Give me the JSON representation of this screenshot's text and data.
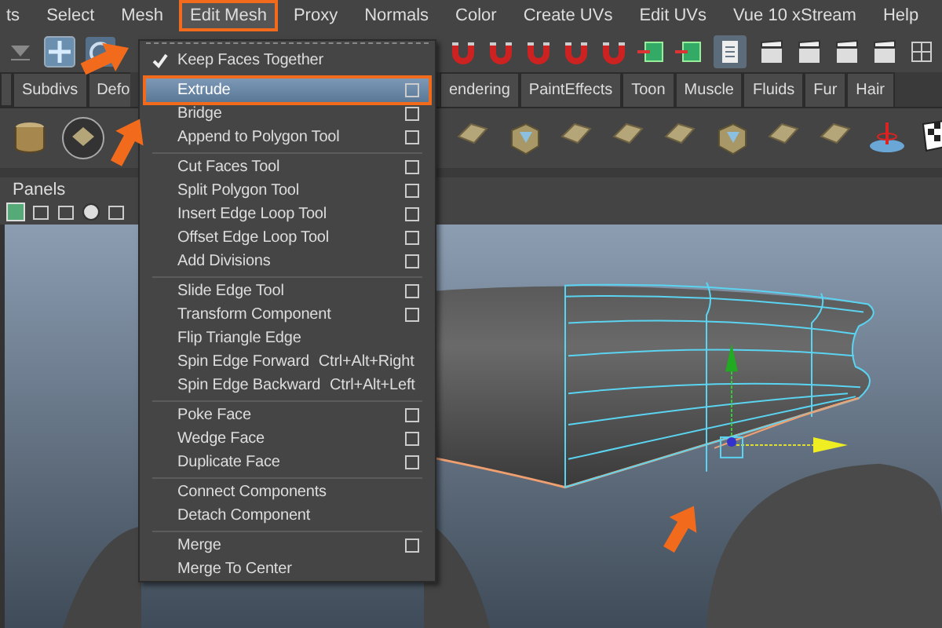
{
  "menu_bar": {
    "items": [
      {
        "label": "ts",
        "selected": false
      },
      {
        "label": "Select",
        "selected": false
      },
      {
        "label": "Mesh",
        "selected": false
      },
      {
        "label": "Edit Mesh",
        "selected": true
      },
      {
        "label": "Proxy",
        "selected": false
      },
      {
        "label": "Normals",
        "selected": false
      },
      {
        "label": "Color",
        "selected": false
      },
      {
        "label": "Create UVs",
        "selected": false
      },
      {
        "label": "Edit UVs",
        "selected": false
      },
      {
        "label": "Vue 10 xStream",
        "selected": false
      },
      {
        "label": "Help",
        "selected": false
      }
    ]
  },
  "shelf_tabs": [
    {
      "label": "Subdivs"
    },
    {
      "label": "Defo"
    },
    {
      "label": "endering"
    },
    {
      "label": "PaintEffects"
    },
    {
      "label": "Toon"
    },
    {
      "label": "Muscle"
    },
    {
      "label": "Fluids"
    },
    {
      "label": "Fur"
    },
    {
      "label": "Hair"
    }
  ],
  "panels_menu": {
    "label": "Panels"
  },
  "edit_mesh_menu": {
    "toggle": {
      "label": "Keep Faces Together",
      "checked": true
    },
    "groups": [
      [
        {
          "label": "Extrude",
          "selected": true,
          "option_box": true
        },
        {
          "label": "Bridge",
          "selected": false,
          "option_box": true
        },
        {
          "label": "Append to Polygon Tool",
          "selected": false,
          "option_box": true
        }
      ],
      [
        {
          "label": "Cut Faces Tool",
          "selected": false,
          "option_box": true
        },
        {
          "label": "Split Polygon Tool",
          "selected": false,
          "option_box": true
        },
        {
          "label": "Insert Edge Loop Tool",
          "selected": false,
          "option_box": true
        },
        {
          "label": "Offset Edge Loop Tool",
          "selected": false,
          "option_box": true
        },
        {
          "label": "Add Divisions",
          "selected": false,
          "option_box": true
        }
      ],
      [
        {
          "label": "Slide Edge Tool",
          "selected": false,
          "option_box": true
        },
        {
          "label": "Transform Component",
          "selected": false,
          "option_box": true
        },
        {
          "label": "Flip Triangle Edge",
          "selected": false,
          "option_box": false
        },
        {
          "label": "Spin Edge Forward",
          "shortcut": "Ctrl+Alt+Right",
          "selected": false,
          "option_box": false
        },
        {
          "label": "Spin Edge Backward",
          "shortcut": "Ctrl+Alt+Left",
          "selected": false,
          "option_box": false
        }
      ],
      [
        {
          "label": "Poke Face",
          "selected": false,
          "option_box": true
        },
        {
          "label": "Wedge Face",
          "selected": false,
          "option_box": true
        },
        {
          "label": "Duplicate Face",
          "selected": false,
          "option_box": true
        }
      ],
      [
        {
          "label": "Connect Components",
          "selected": false,
          "option_box": false
        },
        {
          "label": "Detach Component",
          "selected": false,
          "option_box": false
        }
      ],
      [
        {
          "label": "Merge",
          "selected": false,
          "option_box": true
        },
        {
          "label": "Merge To Center",
          "selected": false,
          "option_box": false
        }
      ]
    ]
  }
}
